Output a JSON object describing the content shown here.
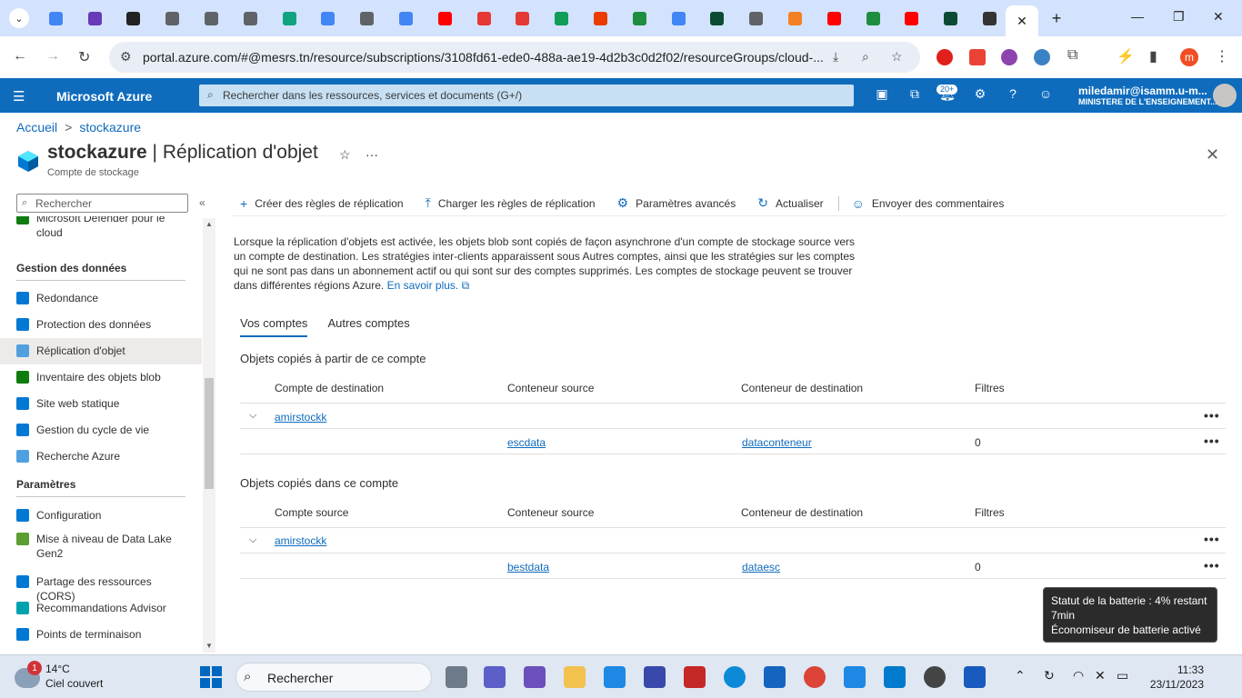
{
  "browser": {
    "url": "portal.azure.com/#@mesrs.tn/resource/subscriptions/3108fd61-ede0-488a-ae19-4d2b3c0d2f02/resourceGroups/cloud-...",
    "tab_close": "✕",
    "new_tab": "+",
    "tab_icons": [
      "google-icon",
      "forms-icon",
      "stackedit-icon",
      "chrome-icon",
      "app-icon",
      "globe-icon",
      "chatgpt-icon",
      "google-icon",
      "globe-icon",
      "google-icon",
      "youtube-icon",
      "app-icon",
      "app-icon",
      "sheets-icon",
      "office-icon",
      "classroom-icon",
      "google-icon",
      "django-icon",
      "globe-icon",
      "stackoverflow-icon",
      "youtube-icon",
      "classroom-icon",
      "youtube-icon",
      "django-icon",
      "app-icon"
    ],
    "tab_colors": [
      "#4285f4",
      "#673ab7",
      "#222222",
      "#5f6368",
      "#5f6368",
      "#5f6368",
      "#10a37f",
      "#4285f4",
      "#5f6368",
      "#4285f4",
      "#ff0000",
      "#e53935",
      "#e53935",
      "#0f9d58",
      "#eb3c00",
      "#1e8e3e",
      "#4285f4",
      "#0c4b33",
      "#5f6368",
      "#f48024",
      "#ff0000",
      "#1e8e3e",
      "#ff0000",
      "#0c4b33",
      "#333333"
    ],
    "profile_letter": "m"
  },
  "azure": {
    "brand": "Microsoft Azure",
    "search_placeholder": "Rechercher dans les ressources, services et documents (G+/)",
    "notifications_count": "20+",
    "user_name": "miledamir@isamm.u-m...",
    "user_org": "MINISTERE DE L'ENSEIGNEMENT..."
  },
  "breadcrumb": [
    "Accueil",
    "stockazure"
  ],
  "breadcrumb_sep": ">",
  "resource": {
    "name": "stockazure",
    "separator": " | ",
    "page": "Réplication d'objet",
    "type": "Compte de stockage",
    "star": "☆",
    "more": "···",
    "close": "✕"
  },
  "sidebar": {
    "search_placeholder": "Rechercher",
    "collapse": "«",
    "items_top": [
      {
        "label": "Microsoft Defender pour le cloud",
        "color": "#107c10"
      }
    ],
    "group_data": "Gestion des données",
    "items_data": [
      {
        "label": "Redondance",
        "color": "#0078d4"
      },
      {
        "label": "Protection des données",
        "color": "#0078d4"
      },
      {
        "label": "Réplication d'objet",
        "color": "#50a0e0",
        "selected": true
      },
      {
        "label": "Inventaire des objets blob",
        "color": "#107c10"
      },
      {
        "label": "Site web statique",
        "color": "#0078d4"
      },
      {
        "label": "Gestion du cycle de vie",
        "color": "#0078d4"
      },
      {
        "label": "Recherche Azure",
        "color": "#50a0e0"
      }
    ],
    "group_settings": "Paramètres",
    "items_settings": [
      {
        "label": "Configuration",
        "color": "#0078d4"
      },
      {
        "label": "Mise à niveau de Data Lake Gen2",
        "color": "#5c9e31"
      },
      {
        "label": "Partage des ressources (CORS)",
        "color": "#0078d4"
      },
      {
        "label": "Recommandations Advisor",
        "color": "#00a2ad"
      },
      {
        "label": "Points de terminaison",
        "color": "#0078d4"
      }
    ]
  },
  "toolbar": [
    {
      "icon": "+",
      "label": "Créer des règles de réplication"
    },
    {
      "icon": "⤒",
      "label": "Charger les règles de réplication"
    },
    {
      "icon": "⚙",
      "label": "Paramètres avancés"
    },
    {
      "icon": "↻",
      "label": "Actualiser"
    },
    {
      "icon": "☺",
      "label": "Envoyer des commentaires"
    }
  ],
  "description": "Lorsque la réplication d'objets est activée, les objets blob sont copiés de façon asynchrone d'un compte de stockage source vers un compte de destination. Les stratégies inter-clients apparaissent sous Autres comptes, ainsi que les stratégies sur les comptes qui ne sont pas dans un abonnement actif ou qui sont sur des comptes supprimés. Les comptes de stockage peuvent se trouver dans différentes régions Azure.",
  "learn_more": "En savoir plus.",
  "external_icon": "⧉",
  "page_tabs": [
    "Vos comptes",
    "Autres comptes"
  ],
  "outgoing": {
    "title": "Objets copiés à partir de ce compte",
    "headers": [
      "Compte de destination",
      "Conteneur source",
      "Conteneur de destination",
      "Filtres"
    ],
    "account": "amirstockk",
    "rows": [
      {
        "source": "escdata",
        "dest": "dataconteneur",
        "filters": "0"
      }
    ]
  },
  "incoming": {
    "title": "Objets copiés dans ce compte",
    "headers": [
      "Compte source",
      "Conteneur source",
      "Conteneur de destination",
      "Filtres"
    ],
    "account": "amirstockk",
    "rows": [
      {
        "source": "bestdata",
        "dest": "dataesc",
        "filters": "0"
      }
    ]
  },
  "more_dots": "•••",
  "expander": "⌵",
  "tooltip": [
    "Statut de la batterie : 4% restant",
    "7min",
    "Économiseur de batterie activé"
  ],
  "taskbar": {
    "weather_badge": "1",
    "temp": "14°C",
    "weather": "Ciel couvert",
    "search": "Rechercher",
    "time": "11:33",
    "date": "23/11/2023"
  }
}
